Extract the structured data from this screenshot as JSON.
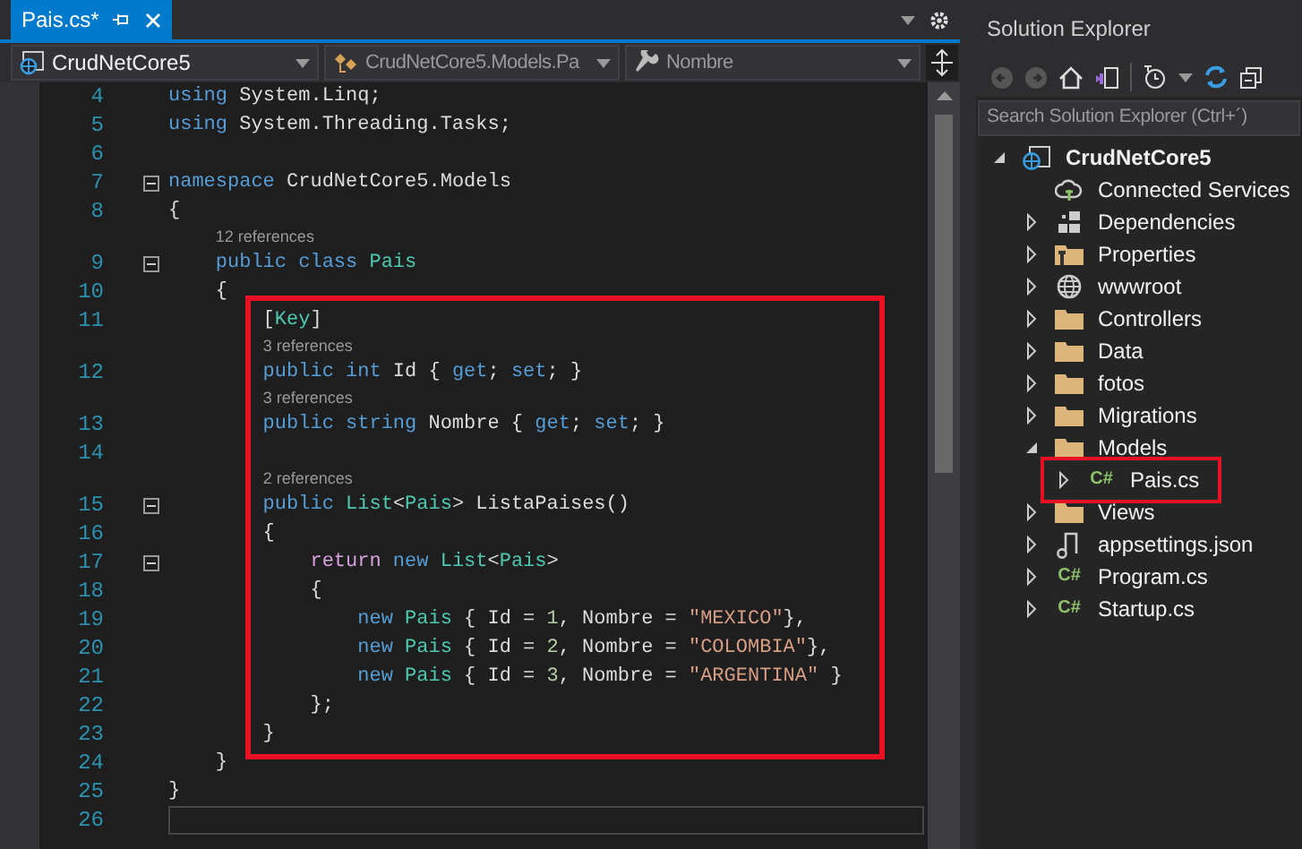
{
  "editor_tab": {
    "label": "Pais.cs*",
    "selected": true
  },
  "nav_bar": [
    {
      "kind": "project",
      "text": "CrudNetCore5"
    },
    {
      "kind": "class",
      "text": "CrudNetCore5.Models.Pa"
    },
    {
      "kind": "member",
      "text": "Nombre"
    }
  ],
  "code_lines": [
    {
      "number": "4",
      "tokens": [
        {
          "text": "using",
          "kind": "kw"
        },
        {
          "text": " System.Linq;",
          "kind": "plain"
        }
      ]
    },
    {
      "number": "5",
      "tokens": [
        {
          "text": "using",
          "kind": "kw"
        },
        {
          "text": " System.Threading.Tasks;",
          "kind": "plain"
        }
      ]
    },
    {
      "number": "6"
    },
    {
      "number": "7",
      "foldable": true,
      "tokens": [
        {
          "text": "namespace",
          "kind": "kw"
        },
        {
          "text": " CrudNetCore5.Models",
          "kind": "plain"
        }
      ]
    },
    {
      "number": "8",
      "tokens": [
        {
          "text": "{",
          "kind": "plain"
        }
      ]
    },
    {
      "number": "9",
      "foldable": true,
      "lens": "12 references",
      "tokens": [
        {
          "text": "    public class ",
          "kind": "kw"
        },
        {
          "text": "Pais",
          "kind": "type"
        }
      ]
    },
    {
      "number": "10",
      "tokens": [
        {
          "text": "    {",
          "kind": "plain"
        }
      ]
    },
    {
      "number": "11",
      "tokens": [
        {
          "text": "        [",
          "kind": "plain"
        },
        {
          "text": "Key",
          "kind": "type"
        },
        {
          "text": "]",
          "kind": "plain"
        }
      ]
    },
    {
      "number": "12",
      "lens": "3 references",
      "tokens": [
        {
          "text": "        public int",
          "kind": "kw"
        },
        {
          "text": " Id { ",
          "kind": "plain"
        },
        {
          "text": "get",
          "kind": "kw"
        },
        {
          "text": "; ",
          "kind": "plain"
        },
        {
          "text": "set",
          "kind": "kw"
        },
        {
          "text": "; }",
          "kind": "plain"
        }
      ]
    },
    {
      "number": "13",
      "lens": "3 references",
      "tokens": [
        {
          "text": "        public string",
          "kind": "kw"
        },
        {
          "text": " Nombre { ",
          "kind": "plain"
        },
        {
          "text": "get",
          "kind": "kw"
        },
        {
          "text": "; ",
          "kind": "plain"
        },
        {
          "text": "set",
          "kind": "kw"
        },
        {
          "text": "; }",
          "kind": "plain"
        }
      ]
    },
    {
      "number": "14"
    },
    {
      "number": "15",
      "foldable": true,
      "lens": "2 references",
      "tokens": [
        {
          "text": "        public ",
          "kind": "kw"
        },
        {
          "text": "List",
          "kind": "type"
        },
        {
          "text": "<",
          "kind": "plain"
        },
        {
          "text": "Pais",
          "kind": "type"
        },
        {
          "text": "> ListaPaises()",
          "kind": "plain"
        }
      ]
    },
    {
      "number": "16",
      "tokens": [
        {
          "text": "        {",
          "kind": "plain"
        }
      ]
    },
    {
      "number": "17",
      "foldable": true,
      "tokens": [
        {
          "text": "            return",
          "kind": "ctrl"
        },
        {
          "text": " new ",
          "kind": "kw"
        },
        {
          "text": "List",
          "kind": "type"
        },
        {
          "text": "<",
          "kind": "plain"
        },
        {
          "text": "Pais",
          "kind": "type"
        },
        {
          "text": ">",
          "kind": "plain"
        }
      ]
    },
    {
      "number": "18",
      "tokens": [
        {
          "text": "            {",
          "kind": "plain"
        }
      ]
    },
    {
      "number": "19",
      "tokens": [
        {
          "text": "                new ",
          "kind": "kw"
        },
        {
          "text": "Pais",
          "kind": "type"
        },
        {
          "text": " { Id = ",
          "kind": "plain"
        },
        {
          "text": "1",
          "kind": "num"
        },
        {
          "text": ", Nombre = ",
          "kind": "plain"
        },
        {
          "text": "\"MEXICO\"",
          "kind": "str"
        },
        {
          "text": "},",
          "kind": "plain"
        }
      ]
    },
    {
      "number": "20",
      "tokens": [
        {
          "text": "                new ",
          "kind": "kw"
        },
        {
          "text": "Pais",
          "kind": "type"
        },
        {
          "text": " { Id = ",
          "kind": "plain"
        },
        {
          "text": "2",
          "kind": "num"
        },
        {
          "text": ", Nombre = ",
          "kind": "plain"
        },
        {
          "text": "\"COLOMBIA\"",
          "kind": "str"
        },
        {
          "text": "},",
          "kind": "plain"
        }
      ]
    },
    {
      "number": "21",
      "tokens": [
        {
          "text": "                new ",
          "kind": "kw"
        },
        {
          "text": "Pais",
          "kind": "type"
        },
        {
          "text": " { Id = ",
          "kind": "plain"
        },
        {
          "text": "3",
          "kind": "num"
        },
        {
          "text": ", Nombre = ",
          "kind": "plain"
        },
        {
          "text": "\"ARGENTINA\"",
          "kind": "str"
        },
        {
          "text": " }",
          "kind": "plain"
        }
      ]
    },
    {
      "number": "22",
      "tokens": [
        {
          "text": "            };",
          "kind": "plain"
        }
      ]
    },
    {
      "number": "23",
      "tokens": [
        {
          "text": "        }",
          "kind": "plain"
        }
      ]
    },
    {
      "number": "24",
      "tokens": [
        {
          "text": "    }",
          "kind": "plain"
        }
      ]
    },
    {
      "number": "25",
      "tokens": [
        {
          "text": "}",
          "kind": "plain"
        }
      ]
    },
    {
      "number": "26",
      "current": true
    }
  ],
  "solution_explorer": {
    "title": "Solution Explorer",
    "search": {
      "placeholder": "Search Solution Explorer (Ctrl+´)"
    },
    "tree": [
      {
        "label": "CrudNetCore5",
        "kind": "project",
        "expanded": true,
        "children": [
          {
            "label": "Connected Services",
            "kind": "service"
          },
          {
            "label": "Dependencies",
            "kind": "deps",
            "expanded": false
          },
          {
            "label": "Properties",
            "kind": "propfolder",
            "expanded": false
          },
          {
            "label": "wwwroot",
            "kind": "globe",
            "expanded": false
          },
          {
            "label": "Controllers",
            "kind": "folder",
            "expanded": false
          },
          {
            "label": "Data",
            "kind": "folder",
            "expanded": false
          },
          {
            "label": "fotos",
            "kind": "folder",
            "expanded": false
          },
          {
            "label": "Migrations",
            "kind": "folder",
            "expanded": false
          },
          {
            "label": "Models",
            "kind": "folder",
            "expanded": true,
            "children": [
              {
                "label": "Pais.cs",
                "kind": "csharp",
                "badge": "C#",
                "expanded": false,
                "highlighted": true
              }
            ]
          },
          {
            "label": "Views",
            "kind": "folder",
            "expanded": false
          },
          {
            "label": "appsettings.json",
            "kind": "json",
            "expanded": false
          },
          {
            "label": "Program.cs",
            "kind": "csharp",
            "badge": "C#",
            "expanded": false
          },
          {
            "label": "Startup.cs",
            "kind": "csharp",
            "badge": "C#",
            "expanded": false
          }
        ]
      }
    ]
  }
}
